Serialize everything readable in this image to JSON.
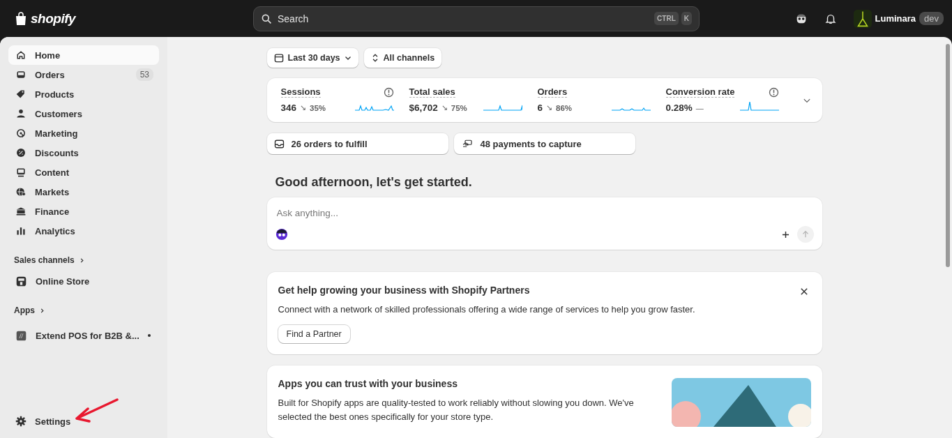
{
  "topbar": {
    "logo": "shopify",
    "search": {
      "placeholder": "Search",
      "keys": [
        "CTRL",
        "K"
      ]
    },
    "store": {
      "name": "Luminara",
      "badge": "dev"
    }
  },
  "sidebar": {
    "items": [
      {
        "label": "Home",
        "selected": true
      },
      {
        "label": "Orders",
        "selected": false,
        "count": "53"
      },
      {
        "label": "Products",
        "selected": false
      },
      {
        "label": "Customers",
        "selected": false
      },
      {
        "label": "Marketing",
        "selected": false
      },
      {
        "label": "Discounts",
        "selected": false
      },
      {
        "label": "Content",
        "selected": false
      },
      {
        "label": "Markets",
        "selected": false
      },
      {
        "label": "Finance",
        "selected": false
      },
      {
        "label": "Analytics",
        "selected": false
      }
    ],
    "sections": [
      {
        "title": "Sales channels",
        "items": [
          {
            "label": "Online Store",
            "kind": "channel",
            "selected": false
          }
        ]
      },
      {
        "title": "Apps",
        "items": [
          {
            "label": "Extend POS for B2B &...",
            "kind": "app",
            "selected": false,
            "unread": true
          }
        ]
      }
    ],
    "settings": {
      "label": "Settings",
      "selected": false
    }
  },
  "filters": [
    {
      "label": "Last 30 days",
      "kind": "calendar"
    },
    {
      "label": "All channels",
      "kind": "sort"
    }
  ],
  "metrics": [
    {
      "label": "Sessions",
      "value": "346",
      "trend": "↘",
      "change": "35%",
      "info": true
    },
    {
      "label": "Total sales",
      "value": "$6,702",
      "trend": "↘",
      "change": "75%",
      "info": false
    },
    {
      "label": "Orders",
      "value": "6",
      "trend": "↘",
      "change": "86%",
      "info": false
    },
    {
      "label": "Conversion rate",
      "value": "0.28%",
      "trend": "—",
      "info": true
    }
  ],
  "tasks": [
    {
      "label": "26 orders to fulfill",
      "kind": "orders"
    },
    {
      "label": "48 payments to capture",
      "kind": "payments"
    }
  ],
  "greeting": "Good afternoon, let's get started.",
  "assistant": {
    "placeholder": "Ask anything..."
  },
  "cards": [
    {
      "title": "Get help growing your business with Shopify Partners",
      "text": "Connect with a network of skilled professionals offering a wide range of services to help you grow faster.",
      "button": "Find a Partner",
      "dismissible": true
    },
    {
      "title": "Apps you can trust with your business",
      "text": "Built for Shopify apps are quality-tested to work reliably without slowing you down. We've selected the best ones specifically for your store type.",
      "image": true,
      "dismissible": false
    }
  ]
}
